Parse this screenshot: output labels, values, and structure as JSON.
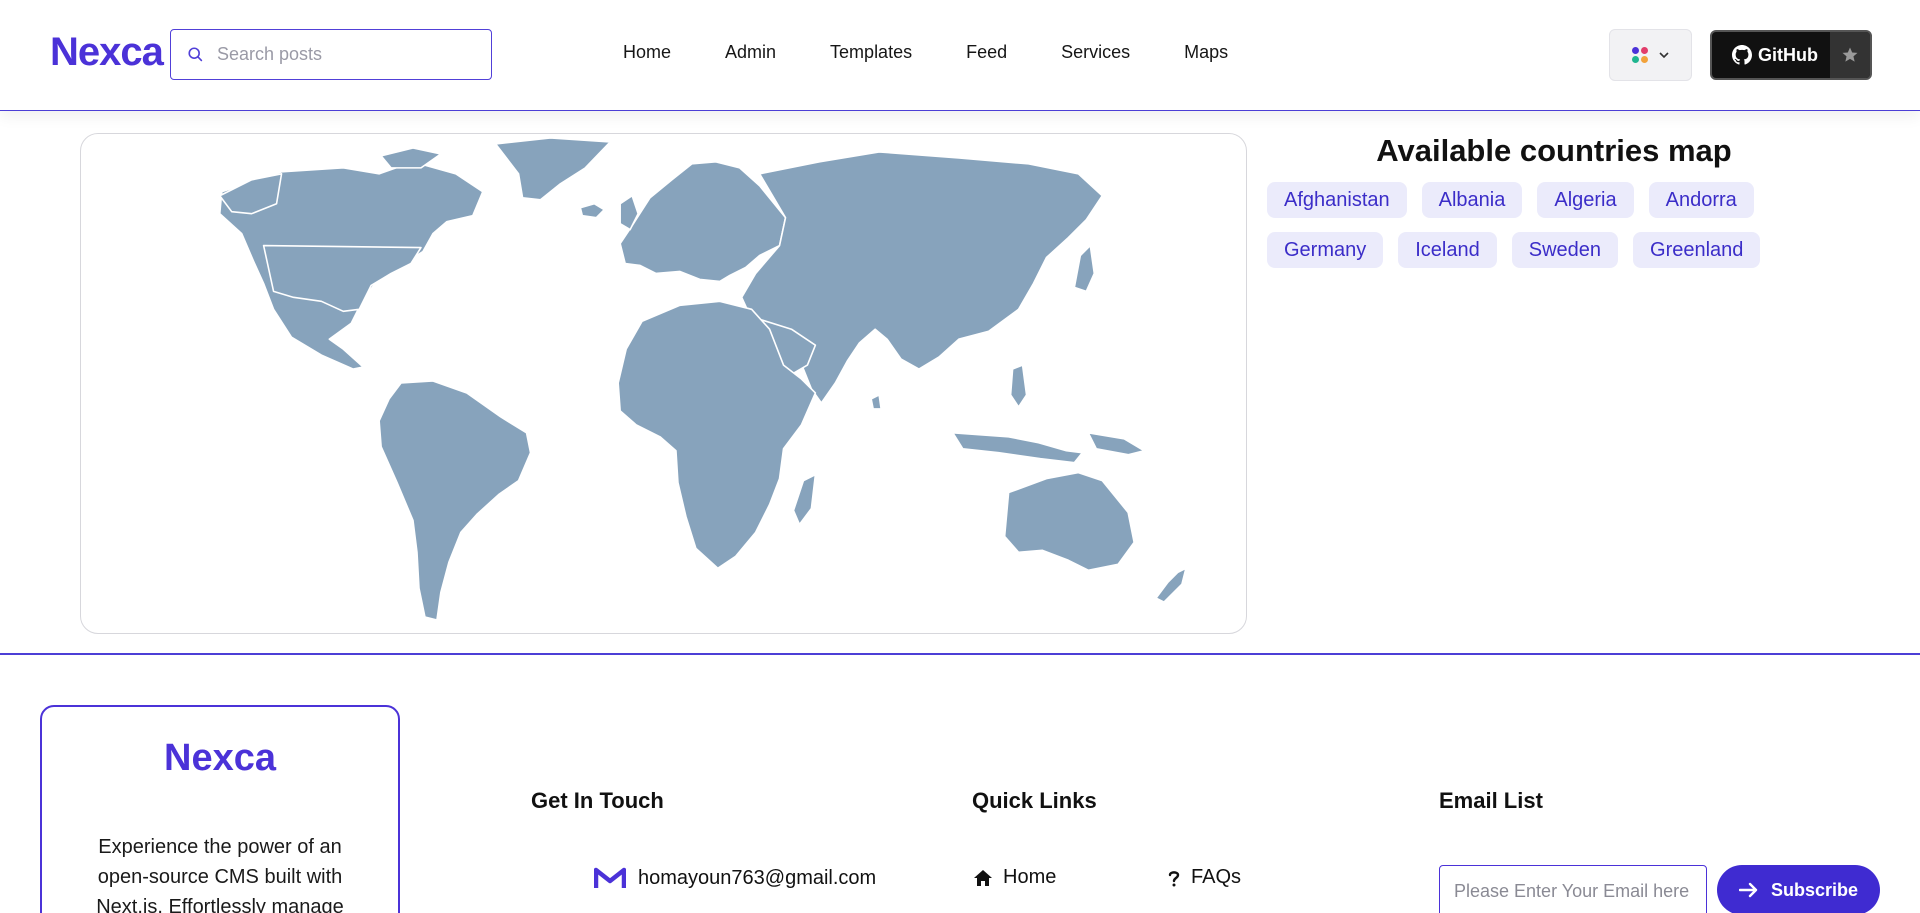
{
  "header": {
    "logo": "Nexca",
    "search_placeholder": "Search posts",
    "nav": [
      "Home",
      "Admin",
      "Templates",
      "Feed",
      "Services",
      "Maps"
    ],
    "github_label": "GitHub"
  },
  "map_section": {
    "title": "Available countries map",
    "countries": [
      "Afghanistan",
      "Albania",
      "Algeria",
      "Andorra",
      "Germany",
      "Iceland",
      "Sweden",
      "Greenland"
    ]
  },
  "footer": {
    "logo": "Nexca",
    "about_text": "Experience the power of an open-source CMS built with Next.js. Effortlessly manage",
    "get_in_touch_title": "Get In Touch",
    "email_contact": "homayoun763@gmail.com",
    "quick_links_title": "Quick Links",
    "quick_links": [
      "Home",
      "FAQs"
    ],
    "email_list_title": "Email List",
    "email_placeholder": "Please Enter Your Email here",
    "subscribe_label": "Subscribe"
  },
  "colors": {
    "brand": "#4b32d8",
    "map_land": "#87a3bc",
    "chip_bg": "#ebebfb"
  },
  "icons": [
    "search-icon",
    "palette-icon",
    "chevron-down-icon",
    "github-icon",
    "star-icon",
    "gmail-icon",
    "home-icon",
    "question-icon",
    "arrow-right-icon"
  ]
}
